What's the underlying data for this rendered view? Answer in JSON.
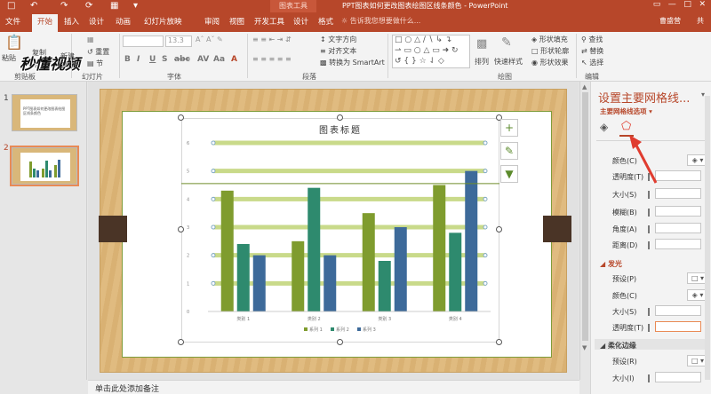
{
  "titlebar": {
    "save_icon": "save-icon",
    "context_tab": "图表工具",
    "title": "PPT图表如何更改图表绘图区线条颜色 - PowerPoint"
  },
  "tabs": [
    "文件",
    "开始",
    "插入",
    "设计",
    "动画",
    "幻灯片放映",
    "审阅",
    "视图",
    "开发工具",
    "设计",
    "格式"
  ],
  "active_tab": 1,
  "tell_me": "告诉我您想要做什么...",
  "user": "曹盛营",
  "share": "共",
  "watermark": "秒懂视频",
  "ribbon": {
    "paste": "粘贴",
    "copy": "复制",
    "format_painter": "格式刷",
    "new_slide_1": "新建",
    "new_slide_2": "幻灯片",
    "reset": "重置",
    "section": "节",
    "font_size": "13.3",
    "text_direction": "文字方向",
    "align_text": "对齐文本",
    "convert_smartart": "转换为 SmartArt",
    "arrange": "排列",
    "quick_styles": "快速样式",
    "shape_fill": "形状填充",
    "shape_outline": "形状轮廓",
    "shape_effects": "形状效果",
    "find": "查找",
    "replace": "替换",
    "select": "选择",
    "groups": {
      "clipboard": "剪贴板",
      "slides": "幻灯片",
      "font": "字体",
      "paragraph": "段落",
      "drawing": "绘图",
      "editing": "编辑"
    }
  },
  "slides": [
    {
      "num": "1"
    },
    {
      "num": "2"
    }
  ],
  "thumb1_text": "PPT图表如何更改图表绘图区线条颜色",
  "chart_data": {
    "type": "bar",
    "title": "图表标题",
    "categories": [
      "类别 1",
      "类别 2",
      "类别 3",
      "类别 4"
    ],
    "series": [
      {
        "name": "系列 1",
        "values": [
          4.3,
          2.5,
          3.5,
          4.5
        ],
        "color": "#7f9c2e"
      },
      {
        "name": "系列 2",
        "values": [
          2.4,
          4.4,
          1.8,
          2.8
        ],
        "color": "#2e8a6e"
      },
      {
        "name": "系列 3",
        "values": [
          2.0,
          2.0,
          3.0,
          5.0
        ],
        "color": "#3d6a9a"
      }
    ],
    "y_ticks": [
      "0",
      "1",
      "2",
      "3",
      "4",
      "5",
      "6"
    ],
    "ylim": [
      0,
      6
    ],
    "gridline_color": "#c9da8a",
    "legend_position": "bottom"
  },
  "float_buttons": [
    "chart-elements-icon",
    "chart-styles-icon",
    "chart-filter-icon"
  ],
  "status": "单击此处添加备注",
  "pane": {
    "title": "设置主要网格线...",
    "subtitle": "主要网格线选项",
    "line_section": {
      "color": "颜色(C)",
      "transparency": "透明度(T)",
      "size": "大小(S)",
      "blur": "模糊(B)",
      "angle": "角度(A)",
      "distance": "距离(D)"
    },
    "glow_section": "发光",
    "glow": {
      "preset": "预设(P)",
      "color": "颜色(C)",
      "size": "大小(S)",
      "transparency": "透明度(T)"
    },
    "soft_edge_section": "柔化边缘",
    "soft_edge": {
      "preset": "预设(R)",
      "size": "大小(I)"
    }
  },
  "colors": {
    "accent": "#b7472a",
    "arrow": "#e03c2f"
  }
}
